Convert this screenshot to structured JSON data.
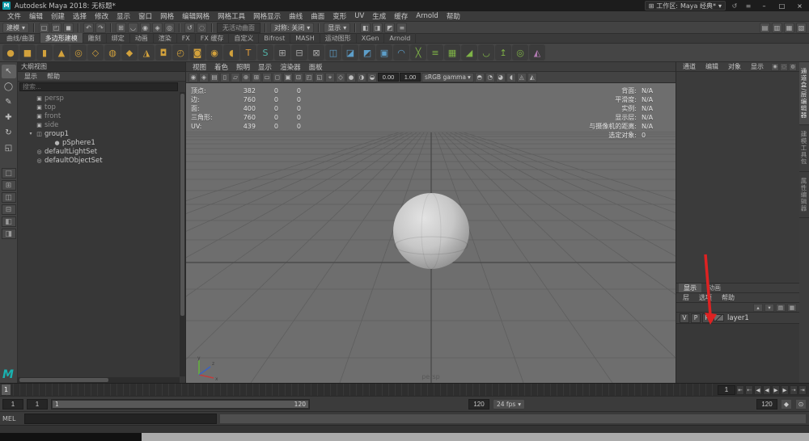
{
  "ui": {
    "caret": "▾"
  },
  "title_bar": {
    "app_icon_glyph": "M",
    "title": "Autodesk Maya 2018: 无标题*",
    "workspace": {
      "icon_glyph": "⊞",
      "label": "工作区:",
      "value": "Maya 经典*"
    },
    "workspace_icons": [
      {
        "name": "workspace-reset-icon",
        "glyph": "↺"
      },
      {
        "name": "workspace-settings-icon",
        "glyph": "≡"
      }
    ],
    "window_buttons": [
      {
        "name": "minimize-button",
        "glyph": "–"
      },
      {
        "name": "maximize-button",
        "glyph": "□"
      },
      {
        "name": "close-button",
        "glyph": "×"
      }
    ]
  },
  "menu_bar": {
    "items": [
      "文件",
      "编辑",
      "创建",
      "选择",
      "修改",
      "显示",
      "窗口",
      "网格",
      "编辑网格",
      "网格工具",
      "网格显示",
      "曲线",
      "曲面",
      "变形",
      "UV",
      "生成",
      "缓存",
      "Arnold",
      "帮助"
    ]
  },
  "status_line": {
    "mode": "建模",
    "no_live_surface": "无活动曲面",
    "symmetry": "对称: 关闭",
    "display": "显示",
    "file_icons": [
      {
        "name": "new-scene-icon",
        "glyph": "□"
      },
      {
        "name": "open-scene-icon",
        "glyph": "◰"
      },
      {
        "name": "save-scene-icon",
        "glyph": "◼"
      }
    ],
    "undo_icons": [
      {
        "name": "undo-icon",
        "glyph": "↶"
      },
      {
        "name": "redo-icon",
        "glyph": "↷"
      }
    ],
    "snap_icons": [
      {
        "name": "snap-to-grid-icon",
        "glyph": "⊞"
      },
      {
        "name": "snap-to-curve-icon",
        "glyph": "◡"
      },
      {
        "name": "snap-to-point-icon",
        "glyph": "◉"
      },
      {
        "name": "snap-to-plane-icon",
        "glyph": "◈"
      },
      {
        "name": "make-live-icon",
        "glyph": "◎"
      }
    ],
    "history_icons": [
      {
        "name": "construction-history-icon",
        "glyph": "↺"
      },
      {
        "name": "highlight-selection-icon",
        "glyph": "◌"
      }
    ],
    "render_icons": [
      {
        "name": "open-render-view-icon",
        "glyph": "◧"
      },
      {
        "name": "render-current-frame-icon",
        "glyph": "◨"
      },
      {
        "name": "ipr-render-icon",
        "glyph": "◩"
      },
      {
        "name": "render-settings-icon",
        "glyph": "≡"
      }
    ],
    "sidebar_icons": [
      {
        "name": "attribute-editor-toggle-icon",
        "glyph": "▤"
      },
      {
        "name": "tool-settings-toggle-icon",
        "glyph": "▥"
      },
      {
        "name": "channel-box-toggle-icon",
        "glyph": "▦"
      },
      {
        "name": "modeling-toolkit-toggle-icon",
        "glyph": "▧"
      }
    ]
  },
  "shelf": {
    "tabs": [
      {
        "label": "曲线/曲面",
        "cls": ""
      },
      {
        "label": "多边形建模",
        "cls": "active"
      },
      {
        "label": "雕刻",
        "cls": ""
      },
      {
        "label": "绑定",
        "cls": ""
      },
      {
        "label": "动画",
        "cls": ""
      },
      {
        "label": "渲染",
        "cls": ""
      },
      {
        "label": "FX",
        "cls": ""
      },
      {
        "label": "FX 缓存",
        "cls": ""
      },
      {
        "label": "自定义",
        "cls": ""
      },
      {
        "label": "Bifrost",
        "cls": ""
      },
      {
        "label": "MASH",
        "cls": ""
      },
      {
        "label": "运动图形",
        "cls": ""
      },
      {
        "label": "XGen",
        "cls": ""
      },
      {
        "label": "Arnold",
        "cls": ""
      }
    ],
    "icons": [
      {
        "name": "poly-sphere-icon",
        "glyph": "●",
        "color": "#d2a13c"
      },
      {
        "name": "poly-cube-icon",
        "glyph": "■",
        "color": "#d2a13c"
      },
      {
        "name": "poly-cylinder-icon",
        "glyph": "▮",
        "color": "#d2a13c"
      },
      {
        "name": "poly-cone-icon",
        "glyph": "▲",
        "color": "#d2a13c"
      },
      {
        "name": "poly-torus-icon",
        "glyph": "◎",
        "color": "#d2a13c"
      },
      {
        "name": "poly-plane-icon",
        "glyph": "◇",
        "color": "#d2a13c"
      },
      {
        "name": "poly-disc-icon",
        "glyph": "◍",
        "color": "#d2a13c"
      },
      {
        "name": "platonic-solid-icon",
        "glyph": "◆",
        "color": "#d2a13c"
      },
      {
        "name": "poly-pyramid-icon",
        "glyph": "◮",
        "color": "#d2a13c"
      },
      {
        "name": "poly-pipe-icon",
        "glyph": "◘",
        "color": "#d2a13c"
      },
      {
        "name": "poly-helix-icon",
        "glyph": "◴",
        "color": "#d2a13c"
      },
      {
        "name": "poly-gear-icon",
        "glyph": "◙",
        "color": "#d2a13c"
      },
      {
        "name": "poly-soccer-ball-icon",
        "glyph": "◉",
        "color": "#d2a13c"
      },
      {
        "name": "poly-super-ellipse-icon",
        "glyph": "◖",
        "color": "#d2a13c"
      },
      {
        "name": "type-tool-icon",
        "glyph": "T",
        "color": "#e09a3a"
      },
      {
        "name": "svg-tool-icon",
        "glyph": "S",
        "color": "#53b4a9"
      },
      {
        "name": "boolean-union-icon",
        "glyph": "⊞",
        "color": "#a8a8a8"
      },
      {
        "name": "boolean-difference-icon",
        "glyph": "⊟",
        "color": "#a8a8a8"
      },
      {
        "name": "boolean-intersection-icon",
        "glyph": "⊠",
        "color": "#a8a8a8"
      },
      {
        "name": "combine-icon",
        "glyph": "◫",
        "color": "#5d9ec9"
      },
      {
        "name": "separate-icon",
        "glyph": "◪",
        "color": "#5d9ec9"
      },
      {
        "name": "extract-icon",
        "glyph": "◩",
        "color": "#5d9ec9"
      },
      {
        "name": "fill-hole-icon",
        "glyph": "▣",
        "color": "#5d9ec9"
      },
      {
        "name": "smooth-icon",
        "glyph": "◠",
        "color": "#5d9ec9"
      },
      {
        "name": "multi-cut-icon",
        "glyph": "╳",
        "color": "#7fb347"
      },
      {
        "name": "insert-edge-loop-icon",
        "glyph": "≡",
        "color": "#7fb347"
      },
      {
        "name": "quad-draw-icon",
        "glyph": "▦",
        "color": "#7fb347"
      },
      {
        "name": "bevel-icon",
        "glyph": "◢",
        "color": "#7fb347"
      },
      {
        "name": "bridge-icon",
        "glyph": "◡",
        "color": "#7fb347"
      },
      {
        "name": "extrude-icon",
        "glyph": "↥",
        "color": "#7fb347"
      },
      {
        "name": "target-weld-icon",
        "glyph": "◎",
        "color": "#7fb347"
      },
      {
        "name": "mirror-icon",
        "glyph": "◭",
        "color": "#b07ab0"
      }
    ]
  },
  "toolbox": {
    "tools": [
      {
        "name": "select-tool",
        "glyph": "↖",
        "cls": "active"
      },
      {
        "name": "lasso-select-tool",
        "glyph": "◯",
        "cls": ""
      },
      {
        "name": "paint-select-tool",
        "glyph": "✎",
        "cls": ""
      },
      {
        "name": "move-tool",
        "glyph": "✚",
        "cls": ""
      },
      {
        "name": "rotate-tool",
        "glyph": "↻",
        "cls": ""
      },
      {
        "name": "scale-tool",
        "glyph": "◱",
        "cls": ""
      }
    ],
    "layouts": [
      {
        "name": "layout-single-pane-button",
        "glyph": "□"
      },
      {
        "name": "layout-four-pane-button",
        "glyph": "⊞"
      },
      {
        "name": "layout-two-pane-side-button",
        "glyph": "◫"
      },
      {
        "name": "layout-two-pane-stacked-button",
        "glyph": "⊟"
      },
      {
        "name": "layout-persp-outliner-button",
        "glyph": "◧"
      },
      {
        "name": "layout-persp-graph-button",
        "glyph": "◨"
      }
    ],
    "logo": "M"
  },
  "outliner": {
    "title": "大纲视图",
    "menus": [
      "显示",
      "帮助"
    ],
    "search_placeholder": "搜索...",
    "items": [
      {
        "name": "outliner-item-persp",
        "label": "persp",
        "glyph": "▣",
        "icon": "camera-icon",
        "cls": "dim",
        "expander": ""
      },
      {
        "name": "outliner-item-top",
        "label": "top",
        "glyph": "▣",
        "icon": "camera-icon",
        "cls": "dim",
        "expander": ""
      },
      {
        "name": "outliner-item-front",
        "label": "front",
        "glyph": "▣",
        "icon": "camera-icon",
        "cls": "dim",
        "expander": ""
      },
      {
        "name": "outliner-item-side",
        "label": "side",
        "glyph": "▣",
        "icon": "camera-icon",
        "cls": "dim",
        "expander": ""
      },
      {
        "name": "outliner-item-group1",
        "label": "group1",
        "glyph": "◫",
        "icon": "group-icon",
        "cls": "",
        "expander": "▾"
      },
      {
        "name": "outliner-item-psphere1",
        "label": "pSphere1",
        "glyph": "●",
        "icon": "mesh-icon",
        "cls": "child",
        "expander": ""
      },
      {
        "name": "outliner-item-defaultlightset",
        "label": "defaultLightSet",
        "glyph": "◎",
        "icon": "set-icon",
        "cls": "",
        "expander": ""
      },
      {
        "name": "outliner-item-defaultobjectset",
        "label": "defaultObjectSet",
        "glyph": "◎",
        "icon": "set-icon",
        "cls": "",
        "expander": ""
      }
    ]
  },
  "viewport": {
    "menus": [
      "视图",
      "着色",
      "照明",
      "显示",
      "渲染器",
      "面板"
    ],
    "toolbar": {
      "icons_left": [
        {
          "name": "viewport-camera-icon",
          "glyph": "◉"
        },
        {
          "name": "lock-camera-icon",
          "glyph": "◈"
        },
        {
          "name": "camera-attributes-icon",
          "glyph": "▤"
        },
        {
          "name": "bookmark-icon",
          "glyph": "▯"
        },
        {
          "name": "image-plane-icon",
          "glyph": "▱"
        },
        {
          "name": "two-d-pan-zoom-icon",
          "glyph": "⊕"
        },
        {
          "name": "grid-toggle-icon",
          "glyph": "⊞"
        },
        {
          "name": "film-gate-icon",
          "glyph": "▭"
        },
        {
          "name": "resolution-gate-icon",
          "glyph": "◻"
        },
        {
          "name": "gate-mask-icon",
          "glyph": "▣"
        },
        {
          "name": "field-chart-icon",
          "glyph": "⊡"
        },
        {
          "name": "safe-action-icon",
          "glyph": "◰"
        },
        {
          "name": "safe-title-icon",
          "glyph": "◱"
        },
        {
          "name": "frame-selected-icon",
          "glyph": "⌖"
        },
        {
          "name": "wireframe-mode-icon",
          "glyph": "◇"
        },
        {
          "name": "shaded-mode-icon",
          "glyph": "●"
        },
        {
          "name": "textured-mode-icon",
          "glyph": "◑"
        },
        {
          "name": "lights-toggle-icon",
          "glyph": "◒"
        }
      ],
      "exposure": "0.00",
      "gamma": "1.00",
      "colorspace": "sRGB gamma",
      "icons_right": [
        {
          "name": "shadows-toggle-icon",
          "glyph": "◓"
        },
        {
          "name": "ao-toggle-icon",
          "glyph": "◔"
        },
        {
          "name": "motion-blur-toggle-icon",
          "glyph": "◕"
        },
        {
          "name": "anti-aliasing-toggle-icon",
          "glyph": "◖"
        },
        {
          "name": "isolate-select-icon",
          "glyph": "◬"
        },
        {
          "name": "x-ray-icon",
          "glyph": "◭"
        }
      ]
    },
    "hud_left": [
      {
        "label": "顶点:",
        "total": "382",
        "selected": "0",
        "other": "0"
      },
      {
        "label": "边:",
        "total": "760",
        "selected": "0",
        "other": "0"
      },
      {
        "label": "面:",
        "total": "400",
        "selected": "0",
        "other": "0"
      },
      {
        "label": "三角形:",
        "total": "760",
        "selected": "0",
        "other": "0"
      },
      {
        "label": "UV:",
        "total": "439",
        "selected": "0",
        "other": "0"
      }
    ],
    "hud_right": [
      {
        "label": "背面:",
        "value": "N/A"
      },
      {
        "label": "平滑度:",
        "value": "N/A"
      },
      {
        "label": "实例:",
        "value": "N/A"
      },
      {
        "label": "显示层:",
        "value": "N/A"
      },
      {
        "label": "与摄像机的距离:",
        "value": "N/A"
      },
      {
        "label": "选定对象:",
        "value": "0"
      }
    ],
    "camera_label": "persp",
    "axis_labels": {
      "x": "x",
      "y": "y",
      "z": "z"
    }
  },
  "channel_box": {
    "menus": [
      "通道",
      "编辑",
      "对象",
      "显示"
    ],
    "corner_icons": [
      {
        "name": "manip-default-icon",
        "glyph": "◉"
      },
      {
        "name": "manip-no-icon",
        "glyph": "◌"
      },
      {
        "name": "manip-invisible-icon",
        "glyph": "◍"
      }
    ]
  },
  "sidebar_tabs": [
    {
      "name": "sidebar-tab-channel-box",
      "label": "通道盒/层编辑器",
      "cls": "active"
    },
    {
      "name": "sidebar-tab-modeling-toolkit",
      "label": "建模工具包",
      "cls": ""
    },
    {
      "name": "sidebar-tab-attribute-editor",
      "label": "属性编辑器",
      "cls": ""
    }
  ],
  "layer_editor": {
    "tabs": [
      {
        "label": "显示",
        "cls": "active"
      },
      {
        "label": "动画",
        "cls": ""
      }
    ],
    "menus": [
      "层",
      "选项",
      "帮助"
    ],
    "buttons": [
      {
        "name": "move-layer-up-button",
        "glyph": "▴"
      },
      {
        "name": "move-layer-down-button",
        "glyph": "▾"
      },
      {
        "name": "create-empty-layer-button",
        "glyph": "▤"
      },
      {
        "name": "create-layer-from-selected-button",
        "glyph": "▦"
      }
    ],
    "layers": [
      {
        "name": "layer-row-layer1",
        "v": "V",
        "p": "P",
        "r": "R",
        "label": "layer1"
      }
    ]
  },
  "time_slider": {
    "current_frame": "1"
  },
  "playback": {
    "buttons": [
      {
        "name": "go-to-start-button",
        "glyph": "⇤"
      },
      {
        "name": "step-back-frame-button",
        "glyph": "⇠"
      },
      {
        "name": "step-back-key-button",
        "glyph": "◀"
      },
      {
        "name": "play-backwards-button",
        "glyph": "◀"
      },
      {
        "name": "play-forwards-button",
        "glyph": "▶"
      },
      {
        "name": "step-forward-key-button",
        "glyph": "▶"
      },
      {
        "name": "step-forward-frame-button",
        "glyph": "⇢"
      },
      {
        "name": "go-to-end-button",
        "glyph": "⇥"
      }
    ]
  },
  "range_slider": {
    "playback_start": "1",
    "anim_start": "1",
    "bar_start": "1",
    "bar_end": "120",
    "anim_end": "120",
    "playback_end": "120",
    "fps": "24 fps",
    "buttons": [
      {
        "name": "auto-keyframe-button",
        "glyph": "◆"
      },
      {
        "name": "animation-preferences-button",
        "glyph": "⊙"
      }
    ]
  },
  "command_line": {
    "label": "MEL"
  },
  "help_line": {
    "text": ""
  }
}
